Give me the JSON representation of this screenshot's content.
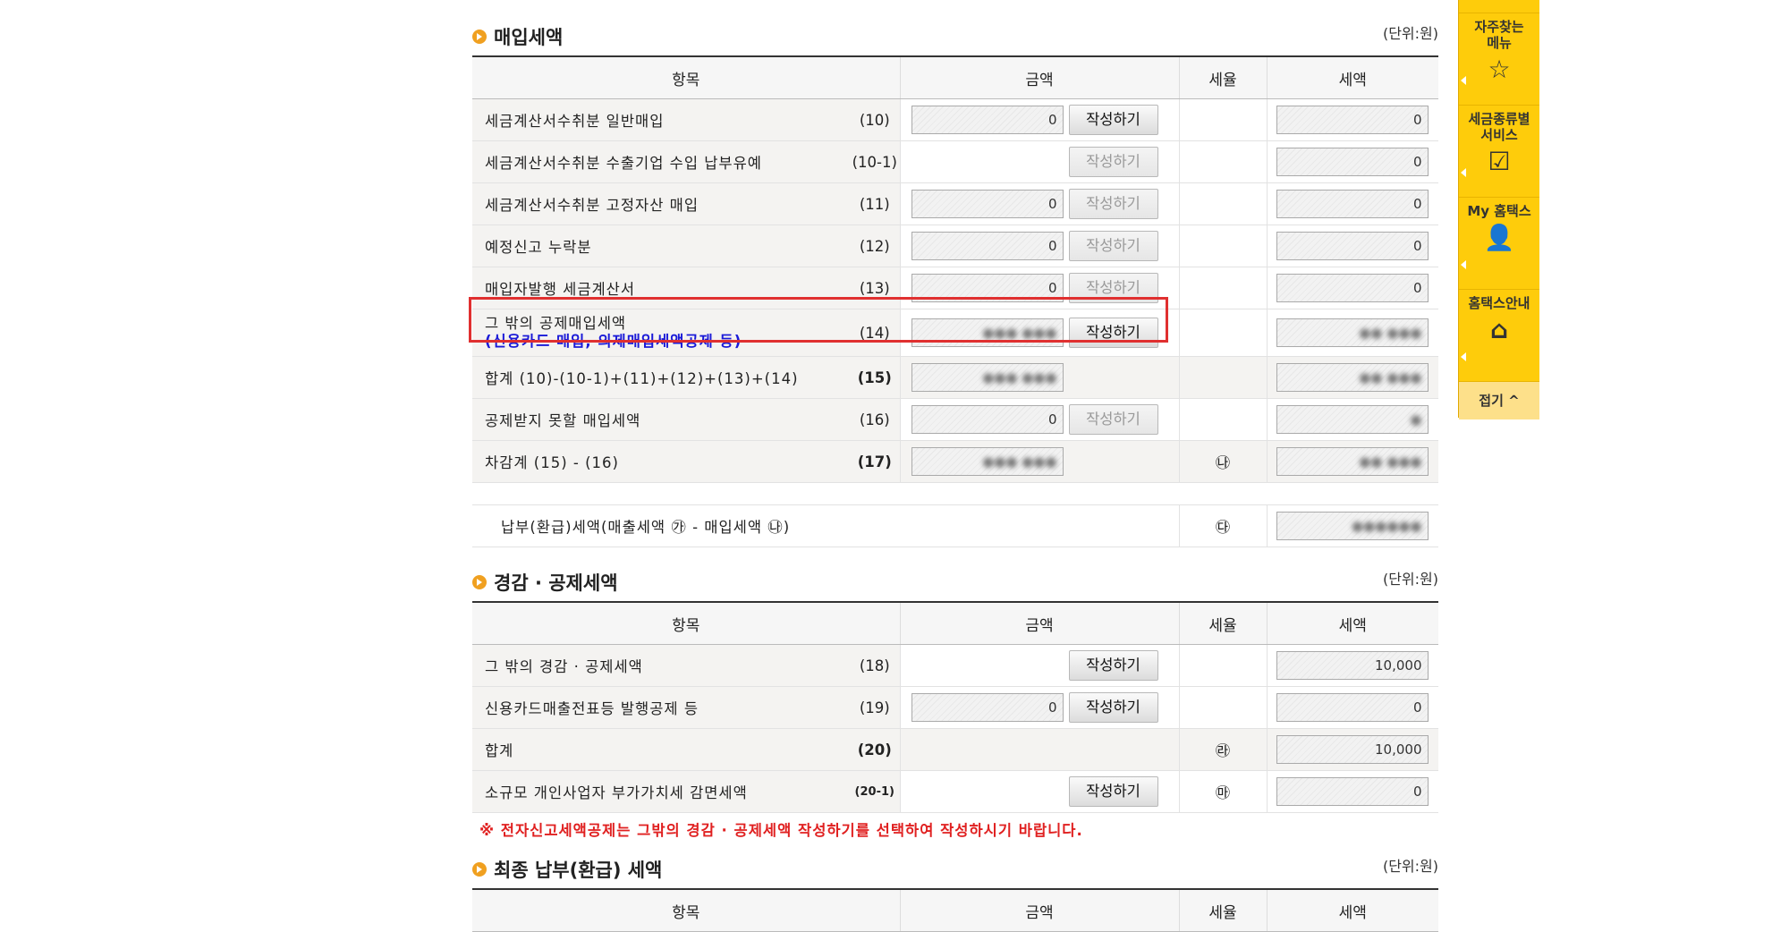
{
  "section1": {
    "title": "매입세액",
    "unit": "(단위:원)",
    "headers": [
      "항목",
      "금액",
      "세율",
      "세액"
    ],
    "rows": [
      {
        "label": "세금계산서수취분 일반매입",
        "no": "(10)",
        "amount": "0",
        "btn": "작성하기",
        "btn_enabled": true,
        "rate": "",
        "tax": "0"
      },
      {
        "label": "세금계산서수취분 수출기업 수입 납부유예",
        "no": "(10-1)",
        "amount": null,
        "btn": "작성하기",
        "btn_enabled": false,
        "rate": "",
        "tax": "0"
      },
      {
        "label": "세금계산서수취분 고정자산 매입",
        "no": "(11)",
        "amount": "0",
        "btn": "작성하기",
        "btn_enabled": false,
        "rate": "",
        "tax": "0"
      },
      {
        "label": "예정신고 누락분",
        "no": "(12)",
        "amount": "0",
        "btn": "작성하기",
        "btn_enabled": false,
        "rate": "",
        "tax": "0"
      },
      {
        "label": "매입자발행 세금계산서",
        "no": "(13)",
        "amount": "0",
        "btn": "작성하기",
        "btn_enabled": false,
        "rate": "",
        "tax": "0"
      },
      {
        "label": "그 밖의 공제매입세액",
        "sublabel": "(신용카드 매입, 의제매입세액공제 등)",
        "no": "(14)",
        "amount": "●●● ●●●",
        "btn": "작성하기",
        "btn_enabled": true,
        "rate": "",
        "tax": "●● ●●●"
      },
      {
        "label": "합계 (10)-(10-1)+(11)+(12)+(13)+(14)",
        "no": "(15)",
        "amount": "●●● ●●●",
        "btn": null,
        "rate": "",
        "tax": "●● ●●●"
      },
      {
        "label": "공제받지 못할 매입세액",
        "no": "(16)",
        "amount": "0",
        "btn": "작성하기",
        "btn_enabled": false,
        "rate": "",
        "tax": "●"
      },
      {
        "label": "차감계 (15) - (16)",
        "no": "(17)",
        "amount": "●●● ●●●",
        "btn": null,
        "rate": "㉯",
        "tax": "●● ●●●"
      }
    ],
    "payable_label": "납부(환급)세액(매출세액 ㉮ - 매입세액 ㉯)",
    "payable_rate": "㉰",
    "payable_tax": "●●●●●●"
  },
  "section2": {
    "title": "경감 · 공제세액",
    "unit": "(단위:원)",
    "headers": [
      "항목",
      "금액",
      "세율",
      "세액"
    ],
    "rows": [
      {
        "label": "그 밖의 경감 · 공제세액",
        "no": "(18)",
        "amount": null,
        "btn": "작성하기",
        "rate": "",
        "tax": "10,000"
      },
      {
        "label": "신용카드매출전표등 발행공제 등",
        "no": "(19)",
        "amount": "0",
        "btn": "작성하기",
        "rate": "",
        "tax": "0"
      },
      {
        "label": "합계",
        "no": "(20)",
        "amount": null,
        "btn": null,
        "rate": "㉱",
        "tax": "10,000"
      },
      {
        "label": "소규모 개인사업자 부가가치세 감면세액",
        "no": "(20-1)",
        "amount": null,
        "btn": "작성하기",
        "rate": "㉲",
        "tax": "0"
      }
    ],
    "note": "※ 전자신고세액공제는 그밖의 경감 · 공제세액 작성하기를 선택하여 작성하시기 바랍니다."
  },
  "section3": {
    "title": "최종 납부(환급) 세액",
    "unit": "(단위:원)",
    "headers": [
      "항목",
      "금액",
      "세율",
      "세액"
    ]
  },
  "sidebar": {
    "items": [
      {
        "label": "자주찾는\n메뉴",
        "icon": "star-icon",
        "glyph": "☆"
      },
      {
        "label": "세금종류별\n서비스",
        "icon": "checkbox-icon",
        "glyph": "☑"
      },
      {
        "label": "My 홈택스",
        "icon": "person-icon",
        "glyph": "👤"
      },
      {
        "label": "홈택스안내",
        "icon": "home-icon",
        "glyph": "⌂"
      }
    ],
    "fold": "접기 ^"
  },
  "colors": {
    "accent": "#fecc0b",
    "highlight": "#e03030",
    "note": "#e02020"
  }
}
